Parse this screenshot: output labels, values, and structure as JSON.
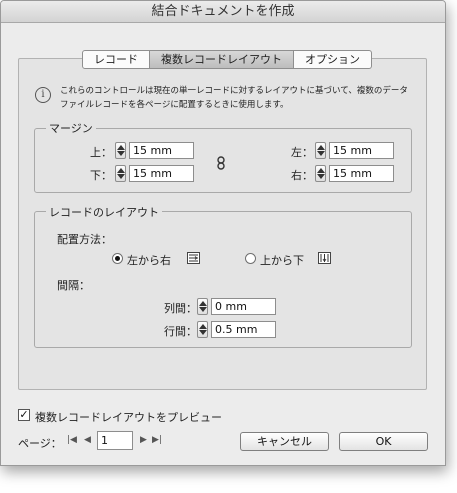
{
  "window": {
    "title": "結合ドキュメントを作成"
  },
  "tabs": [
    {
      "label": "レコード",
      "selected": false
    },
    {
      "label": "複数レコードレイアウト",
      "selected": true
    },
    {
      "label": "オプション",
      "selected": false
    }
  ],
  "info": {
    "icon": "info-icon",
    "text": "これらのコントロールは現在の単一レコードに対するレイアウトに基づいて、複数のデータファイルレコードを各ページに配置するときに使用します。"
  },
  "margins": {
    "title": "マージン",
    "top": {
      "label": "上：",
      "value": "15 mm"
    },
    "bottom": {
      "label": "下：",
      "value": "15 mm"
    },
    "left": {
      "label": "左：",
      "value": "15 mm"
    },
    "right": {
      "label": "右：",
      "value": "15 mm"
    },
    "link_icon": "chain-link-icon"
  },
  "layout": {
    "title": "レコードのレイアウト",
    "placement_label": "配置方法：",
    "options": [
      {
        "label": "左から右",
        "selected": true,
        "icon": "rows-first-icon"
      },
      {
        "label": "上から下",
        "selected": false,
        "icon": "columns-first-icon"
      }
    ],
    "spacing_label": "間隔：",
    "column_gap": {
      "label": "列間：",
      "value": "0 mm"
    },
    "row_gap": {
      "label": "行間：",
      "value": "0.5 mm"
    }
  },
  "preview": {
    "label": "複数レコードレイアウトをプレビュー",
    "checked": true
  },
  "pagination": {
    "label": "ページ：",
    "value": "1"
  },
  "buttons": {
    "cancel": "キャンセル",
    "ok": "OK"
  }
}
